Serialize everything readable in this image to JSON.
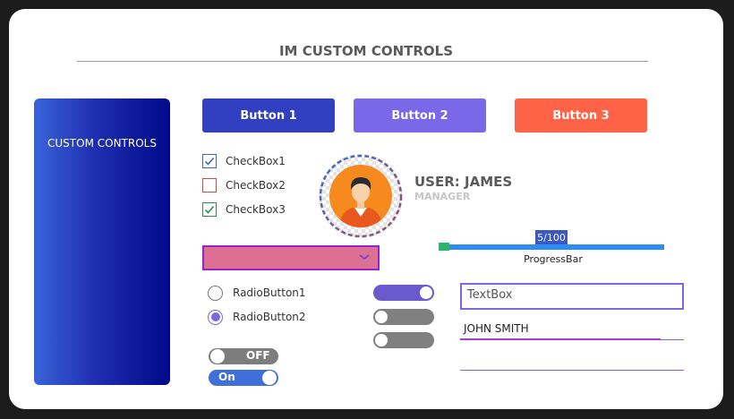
{
  "title": "IM CUSTOM CONTROLS",
  "side_panel": {
    "label": "CUSTOM CONTROLS"
  },
  "buttons": [
    {
      "label": "Button 1",
      "color": "#3040c0"
    },
    {
      "label": "Button 2",
      "color": "#7b68e8"
    },
    {
      "label": "Button 3",
      "color": "#fe6347"
    }
  ],
  "checkboxes": [
    {
      "label": "CheckBox1",
      "checked": true,
      "color": "#3a66c8"
    },
    {
      "label": "CheckBox2",
      "checked": false,
      "color": "#c84c4c"
    },
    {
      "label": "CheckBox3",
      "checked": true,
      "color": "#2e8b57"
    }
  ],
  "user": {
    "name": "USER: JAMES",
    "role": "MANAGER",
    "avatar_icon": "user-avatar-icon"
  },
  "combobox": {
    "value": "",
    "color": "#db7093",
    "border": "#9b1fd0"
  },
  "progress": {
    "value": 5,
    "max": 100,
    "label": "5/100",
    "caption": "ProgressBar"
  },
  "radios": [
    {
      "label": "RadioButton1",
      "selected": false
    },
    {
      "label": "RadioButton2",
      "selected": true
    }
  ],
  "toggles": [
    {
      "on": true,
      "color": "#6a5acd"
    },
    {
      "on": false,
      "color": "#808080"
    },
    {
      "on": false,
      "color": "#808080"
    }
  ],
  "text_toggles": [
    {
      "label": "OFF",
      "on": false
    },
    {
      "label": "On",
      "on": true
    }
  ],
  "textbox": {
    "placeholder": "TextBox"
  },
  "name_field": {
    "value": "JOHN SMITH"
  }
}
